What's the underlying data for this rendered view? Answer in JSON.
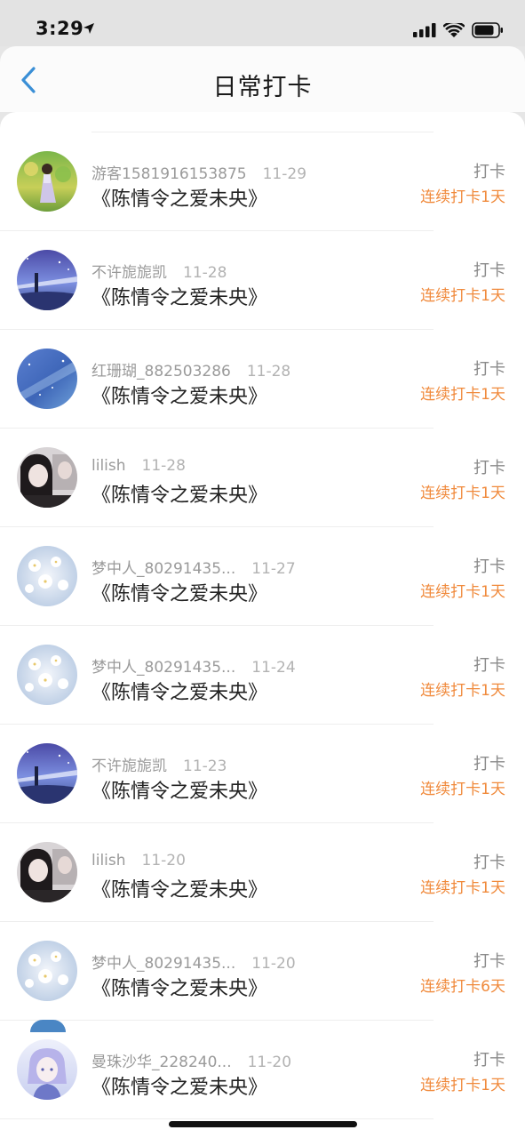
{
  "status_bar": {
    "time": "3:29"
  },
  "header": {
    "title": "日常打卡",
    "back_icon": "chevron-left-icon"
  },
  "colors": {
    "accent": "#3a8fd6",
    "streak": "#f08a3c"
  },
  "list": [
    {
      "user": "游客1581916153875",
      "date": "11-29",
      "book": "《陈情令之爱未央》",
      "action": "打卡",
      "streak": "连续打卡1天",
      "avatar": "avatar-girl-field"
    },
    {
      "user": "不许旎旎凯",
      "date": "11-28",
      "book": "《陈情令之爱未央》",
      "action": "打卡",
      "streak": "连续打卡1天",
      "avatar": "avatar-lighthouse"
    },
    {
      "user": "红珊瑚_882503286",
      "date": "11-28",
      "book": "《陈情令之爱未央》",
      "action": "打卡",
      "streak": "连续打卡1天",
      "avatar": "avatar-starry-sky"
    },
    {
      "user": "lilish",
      "date": "11-28",
      "book": "《陈情令之爱未央》",
      "action": "打卡",
      "streak": "连续打卡1天",
      "avatar": "avatar-portrait"
    },
    {
      "user": "梦中人_80291435...",
      "date": "11-27",
      "book": "《陈情令之爱未央》",
      "action": "打卡",
      "streak": "连续打卡1天",
      "avatar": "avatar-white-flowers"
    },
    {
      "user": "梦中人_80291435...",
      "date": "11-24",
      "book": "《陈情令之爱未央》",
      "action": "打卡",
      "streak": "连续打卡1天",
      "avatar": "avatar-white-flowers"
    },
    {
      "user": "不许旎旎凯",
      "date": "11-23",
      "book": "《陈情令之爱未央》",
      "action": "打卡",
      "streak": "连续打卡1天",
      "avatar": "avatar-lighthouse"
    },
    {
      "user": "lilish",
      "date": "11-20",
      "book": "《陈情令之爱未央》",
      "action": "打卡",
      "streak": "连续打卡1天",
      "avatar": "avatar-portrait"
    },
    {
      "user": "梦中人_80291435...",
      "date": "11-20",
      "book": "《陈情令之爱未央》",
      "action": "打卡",
      "streak": "连续打卡6天",
      "avatar": "avatar-white-flowers"
    },
    {
      "user": "曼珠沙华_228240...",
      "date": "11-20",
      "book": "《陈情令之爱未央》",
      "action": "打卡",
      "streak": "连续打卡1天",
      "avatar": "avatar-anime-character"
    }
  ]
}
